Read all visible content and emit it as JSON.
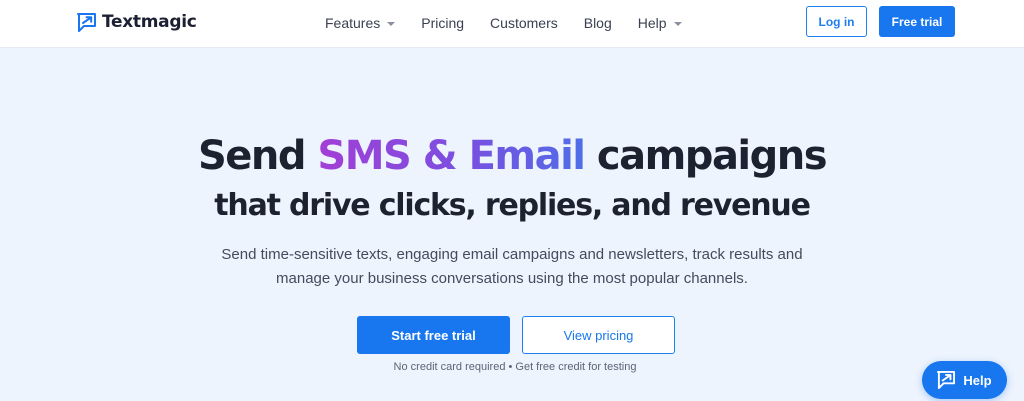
{
  "brand": {
    "name": "Textmagic",
    "accent": "#1877ee"
  },
  "nav": {
    "items": [
      {
        "label": "Features",
        "has_dropdown": true
      },
      {
        "label": "Pricing",
        "has_dropdown": false
      },
      {
        "label": "Customers",
        "has_dropdown": false
      },
      {
        "label": "Blog",
        "has_dropdown": false
      },
      {
        "label": "Help",
        "has_dropdown": true
      }
    ],
    "login_label": "Log in",
    "free_trial_label": "Free trial"
  },
  "hero": {
    "title_prefix": "Send ",
    "title_highlight": "SMS & Email",
    "title_suffix": " campaigns",
    "subtitle": "that drive clicks, replies, and revenue",
    "description_line1": "Send time-sensitive texts, engaging email campaigns and newsletters, track results and",
    "description_line2": "manage your business conversations using the most popular channels.",
    "primary_cta": "Start free trial",
    "secondary_cta": "View pricing",
    "note": "No credit card required • Get free credit for testing"
  },
  "help_widget": {
    "label": "Help",
    "icon": "chat-bubble-icon"
  }
}
